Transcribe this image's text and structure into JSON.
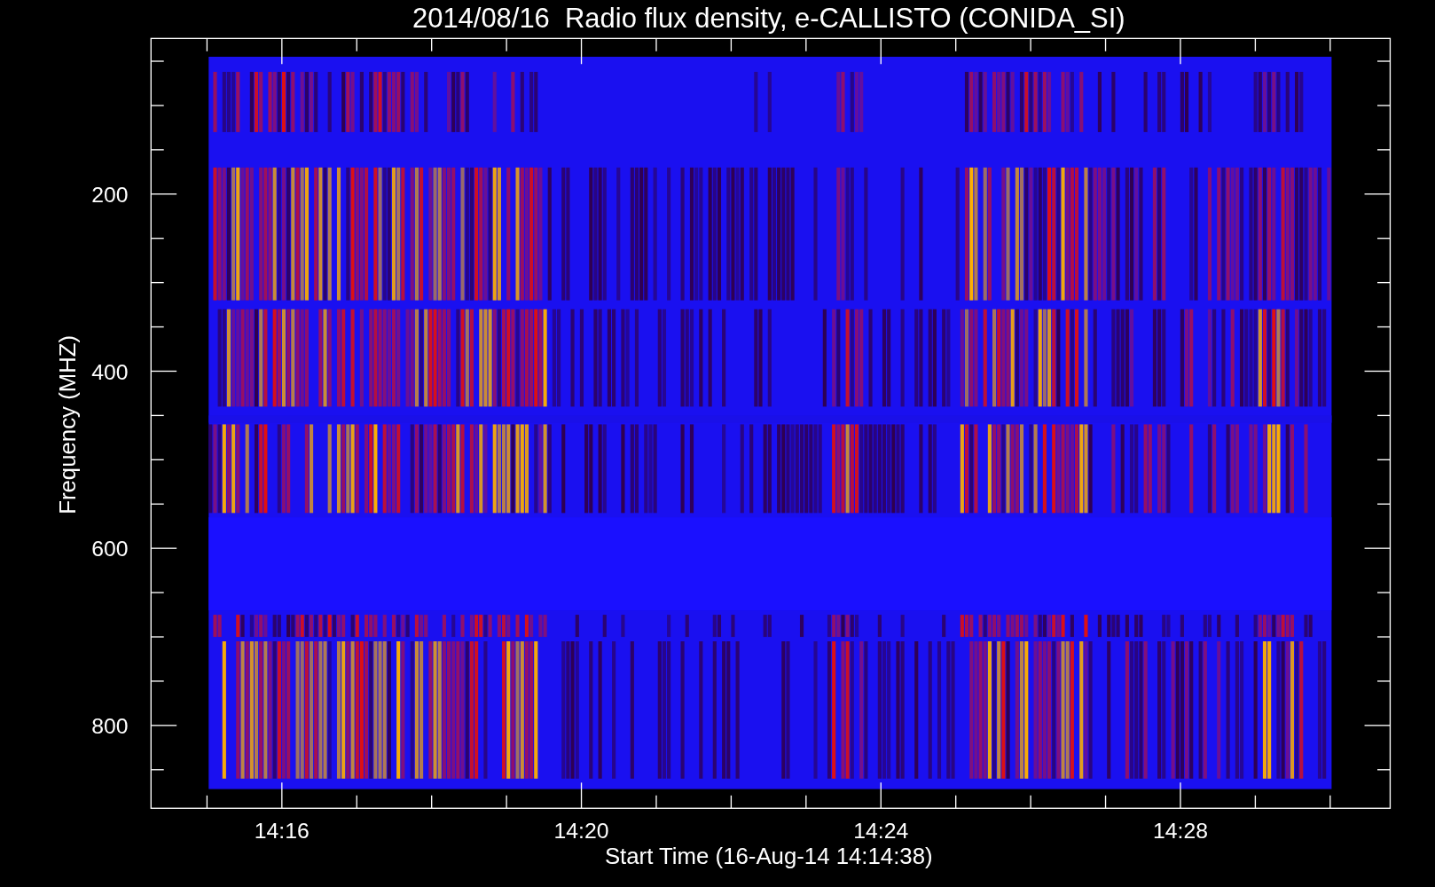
{
  "title": "2014/08/16  Radio flux density, e-CALLISTO (CONIDA_SI)",
  "ylabel": "Frequency (MHZ)",
  "xlabel": "Start Time (16-Aug-14 14:14:38)",
  "ytick_labels": [
    "200",
    "400",
    "600",
    "800"
  ],
  "xtick_labels": [
    "14:16",
    "14:20",
    "14:24",
    "14:28"
  ]
}
